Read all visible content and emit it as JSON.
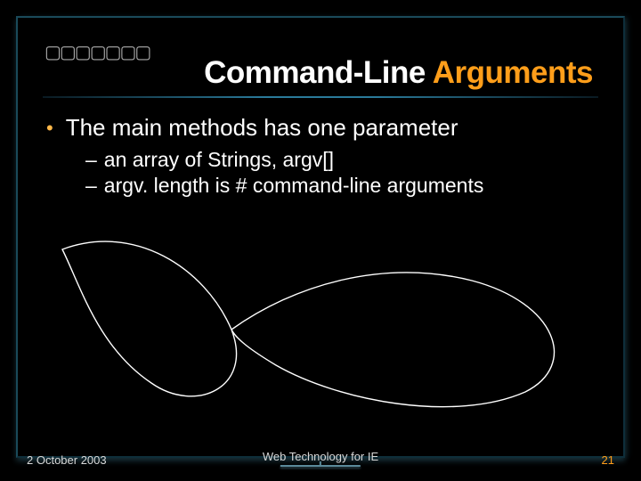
{
  "decor": {
    "corner_glyphs": "▢▢▢▢▢▢▢"
  },
  "title": {
    "plain": "Command-Line ",
    "accent": "Arguments"
  },
  "bullets": [
    {
      "text": "The main methods has one parameter",
      "subs": [
        "an array of Strings, argv[]",
        "argv. length is # command-line arguments"
      ]
    }
  ],
  "footer": {
    "date": "2 October 2003",
    "center": "Web Technology for IE",
    "page": "21"
  }
}
